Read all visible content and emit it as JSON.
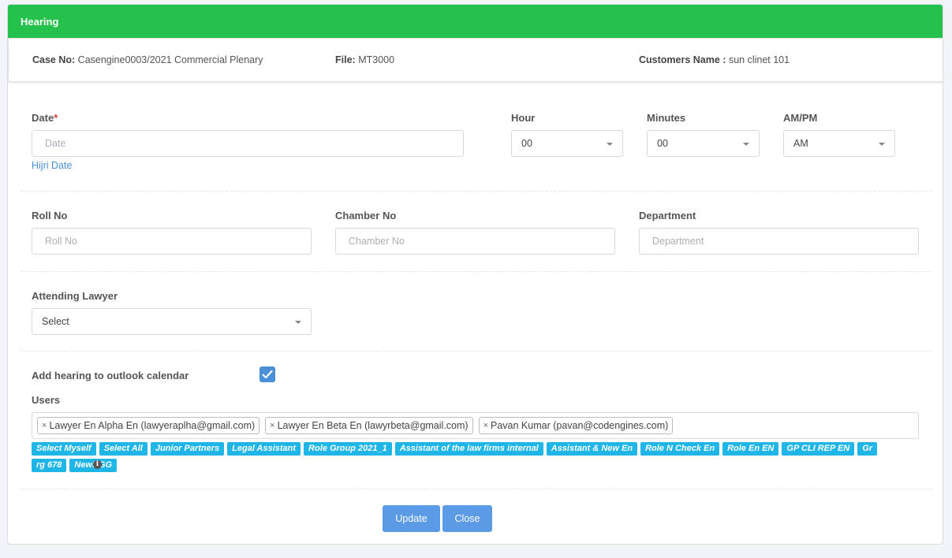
{
  "header": {
    "title": "Hearing"
  },
  "info": {
    "case_label": "Case No:",
    "case_value": "Casengine0003/2021 Commercial Plenary",
    "file_label": "File:",
    "file_value": "MT3000",
    "customer_label": "Customers Name :",
    "customer_value": "sun clinet 101"
  },
  "date": {
    "label": "Date",
    "required": "*",
    "placeholder": "Date",
    "hijri_link": "Hijri Date"
  },
  "hour": {
    "label": "Hour",
    "value": "00"
  },
  "minutes": {
    "label": "Minutes",
    "value": "00"
  },
  "ampm": {
    "label": "AM/PM",
    "value": "AM"
  },
  "roll": {
    "label": "Roll No",
    "placeholder": "Roll No"
  },
  "chamber": {
    "label": "Chamber No",
    "placeholder": "Chamber No"
  },
  "department": {
    "label": "Department",
    "placeholder": "Department"
  },
  "lawyer": {
    "label": "Attending Lawyer",
    "value": "Select"
  },
  "outlook": {
    "label": "Add hearing to outlook calendar",
    "checked": true
  },
  "users": {
    "label": "Users",
    "selected": [
      "Lawyer En Alpha En (lawyeraplha@gmail.com)",
      "Lawyer En Beta En (lawyrbeta@gmail.com)",
      "Pavan Kumar (pavan@codengines.com)"
    ],
    "remove_symbol": "×",
    "groups": [
      "Select Myself",
      "Select All",
      "Junior Partners",
      "Legal Assistant",
      "Role Group 2021_1",
      "Assistant of the law firms internal",
      "Assistant & New En",
      "Role N Check En",
      "Role En EN",
      "GP CLI REP EN",
      "Gr",
      "rg 678",
      "NewRGG"
    ]
  },
  "buttons": {
    "update": "Update",
    "close": "Close"
  },
  "colors": {
    "header": "#24c14c",
    "accent": "#4a90d9",
    "tag": "#1fb5e6",
    "button": "#5b9be6"
  }
}
